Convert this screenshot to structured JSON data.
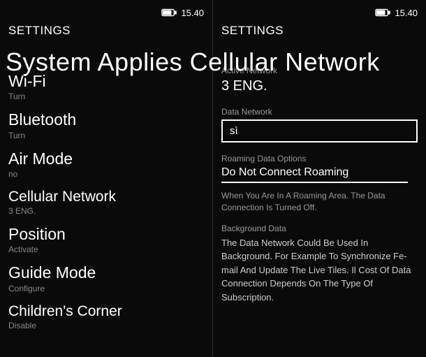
{
  "statusBar": {
    "time": "15.40"
  },
  "leftPanel": {
    "header": "SETTINGS",
    "items": [
      {
        "title": "Wi-Fi",
        "subtitle": "Turn"
      },
      {
        "title": "Bluetooth",
        "subtitle": "Turn"
      },
      {
        "title": "Air Mode",
        "subtitle": "no"
      },
      {
        "title": "Cellular Network",
        "subtitle": "3 ENG."
      },
      {
        "title": "Position",
        "subtitle": "Activate"
      },
      {
        "title": "Guide Mode",
        "subtitle": "Configure"
      },
      {
        "title": "Children's Corner",
        "subtitle": "Disable"
      }
    ]
  },
  "rightPanel": {
    "header": "SETTINGS",
    "activeNetwork": {
      "label": "Active Network",
      "value": "3 ENG."
    },
    "dataNetwork": {
      "label": "Data Network",
      "value": "sì"
    },
    "roamingOptions": {
      "label": "Roaming Data Options",
      "value": "Do Not Connect Roaming",
      "help": "When You Are In A Roaming Area. The Data Connection Is Turned Off."
    },
    "backgroundData": {
      "label": "Background Data",
      "description": "The Data Network Could Be Used In Background. For Example To Synchronize Fe-mail And Update The Live Tiles. Il Cost Of Data Connection Depends On The Type Of Subscription."
    }
  },
  "overlayTitle": "System Applies Cellular Network"
}
